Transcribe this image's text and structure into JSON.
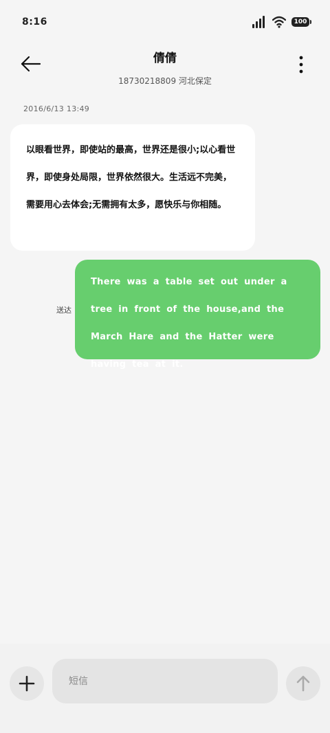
{
  "status": {
    "time": "8:16",
    "battery": "100",
    "icons": [
      "signal-icon",
      "wifi-icon",
      "battery-icon"
    ]
  },
  "header": {
    "title": "倩倩",
    "subtitle": "18730218809  河北保定",
    "back_icon": "arrow-left-icon",
    "more_icon": "more-vertical-icon"
  },
  "conversation": {
    "timestamp": "2016/6/13  13:49",
    "messages": [
      {
        "direction": "incoming",
        "text": "以眼看世界，即使站的最高，世界还是很小;以心看世界，即使身处局限，世界依然很大。生活远不完美，需要用心去体会;无需拥有太多，愿快乐与你相随。"
      },
      {
        "direction": "outgoing",
        "text": "There was a table set out under a tree in front of the house,and the March Hare and the Hatter were having tea at it.",
        "status": "送达"
      }
    ]
  },
  "input_bar": {
    "placeholder": "短信",
    "add_icon": "plus-icon",
    "send_icon": "arrow-up-icon"
  },
  "colors": {
    "background": "#f5f5f5",
    "incoming_bubble": "#ffffff",
    "outgoing_bubble": "#67ce6e",
    "input_background": "#e4e4e4"
  }
}
